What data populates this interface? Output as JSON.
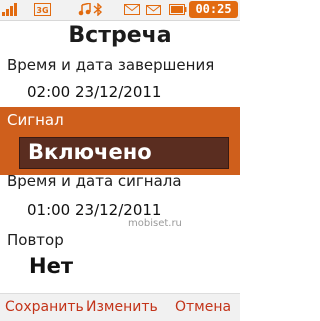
{
  "status_bar": {
    "icons": [
      "signal-icon",
      "network-3g-icon",
      "music-player-icon",
      "bluetooth-icon",
      "sms-icon",
      "mail-icon",
      "battery-icon"
    ],
    "clock": "00:25",
    "accent_color": "#e26b10"
  },
  "title": "Встреча",
  "fields": {
    "end_time": {
      "label": "Время и дата завершения",
      "value": "02:00 23/12/2011"
    },
    "alarm": {
      "label": "Сигнал",
      "value": "Включено"
    },
    "alarm_time": {
      "label": "Время и дата сигнала",
      "value": "01:00 23/12/2011"
    },
    "repeat": {
      "label": "Повтор",
      "value": "Нет"
    }
  },
  "watermark": "mobiset.ru",
  "softkeys": {
    "left": "Сохранить",
    "center": "Изменить",
    "right": "Отмена"
  },
  "colors": {
    "selection": "#cf5f1c",
    "selection_box": "#5a2d20",
    "softkey_text": "#c3341a"
  }
}
